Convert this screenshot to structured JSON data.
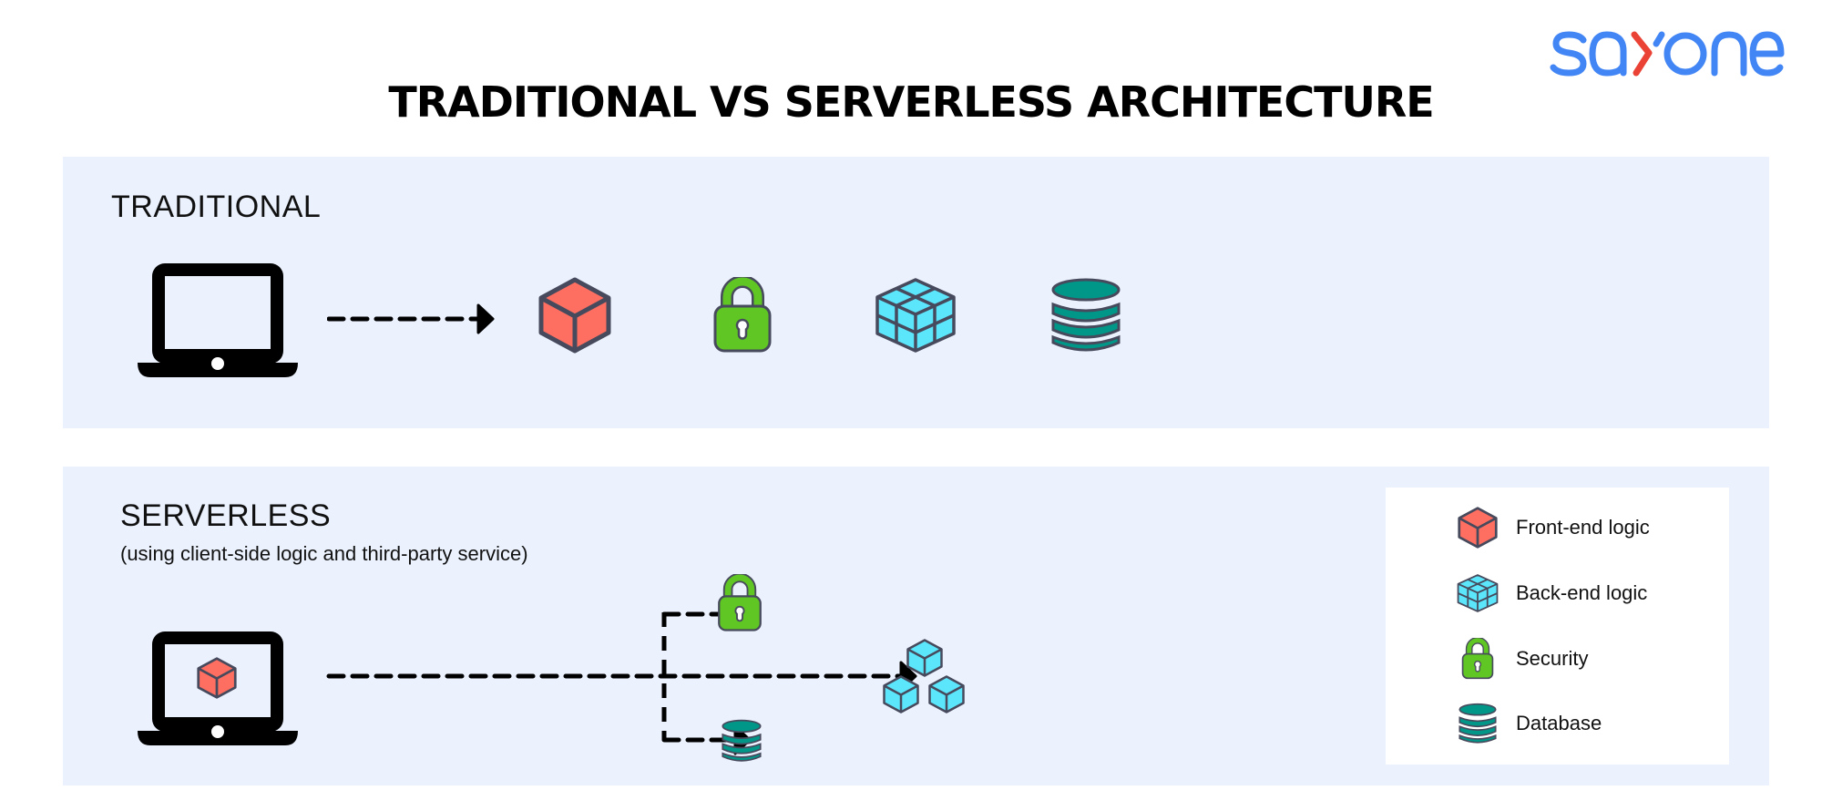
{
  "brand": {
    "logo_text": "sayone",
    "logo_primary_color": "#4285f4",
    "logo_accent_color": "#ea4335"
  },
  "title": "TRADITIONAL VS SERVERLESS ARCHITECTURE",
  "colors": {
    "panel_background": "#ebf2fe",
    "front_end": "#ff6f61",
    "back_end": "#5ce6fb",
    "security": "#5fc623",
    "database": "#009688",
    "icon_outline": "#474a5c",
    "arrow": "#000000"
  },
  "traditional": {
    "heading": "TRADITIONAL",
    "flow": [
      "laptop-icon",
      "arrow-right",
      "front-end-cube-icon",
      "lock-icon",
      "back-end-cube-grid-icon",
      "database-icon"
    ]
  },
  "serverless": {
    "heading": "SERVERLESS",
    "subheading": "(using client-side logic and third-party service)",
    "client": "laptop-with-front-end-cube-icon",
    "branches": [
      {
        "target": "security",
        "icon": "lock-icon"
      },
      {
        "target": "back-end-services",
        "icon": "cube-cluster-icon"
      },
      {
        "target": "database",
        "icon": "database-icon"
      }
    ]
  },
  "legend": {
    "items": [
      {
        "icon": "front-end-cube-icon",
        "label": "Front-end logic"
      },
      {
        "icon": "back-end-cube-grid-icon",
        "label": "Back-end logic"
      },
      {
        "icon": "lock-icon",
        "label": "Security"
      },
      {
        "icon": "database-icon",
        "label": "Database"
      }
    ]
  }
}
